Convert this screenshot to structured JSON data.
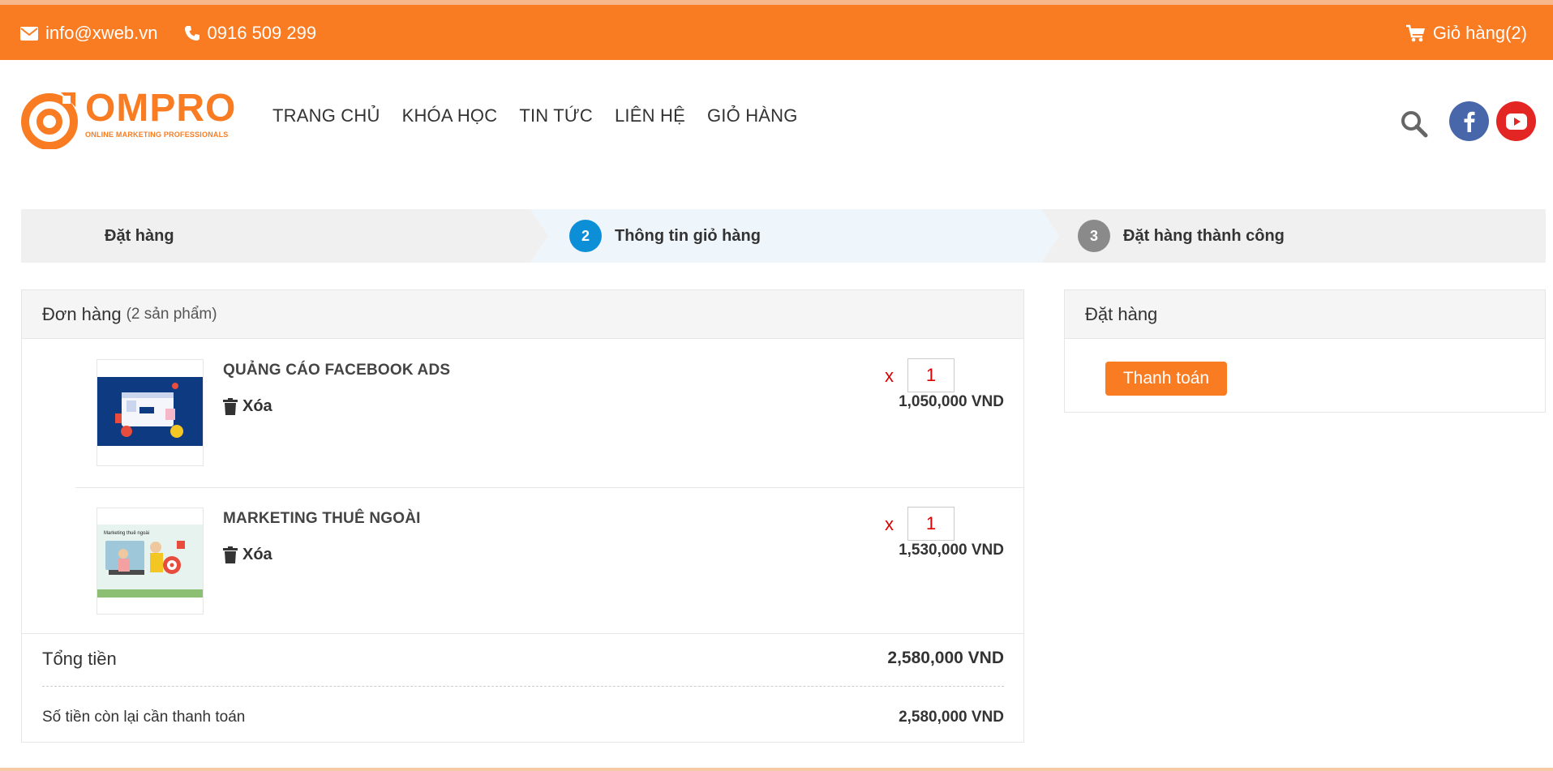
{
  "topbar": {
    "email": "info@xweb.vn",
    "phone": "0916 509 299",
    "cart_label": "Giỏ hàng(2)"
  },
  "logo": {
    "title": "OMPRO",
    "subtitle": "ONLINE MARKETING PROFESSIONALS"
  },
  "nav": {
    "items": [
      {
        "label": "TRANG CHỦ"
      },
      {
        "label": "KHÓA HỌC"
      },
      {
        "label": "TIN TỨC"
      },
      {
        "label": "LIÊN HỆ"
      },
      {
        "label": "GIỎ HÀNG"
      }
    ]
  },
  "steps": [
    {
      "number": "",
      "label": "Đặt hàng"
    },
    {
      "number": "2",
      "label": "Thông tin giỏ hàng"
    },
    {
      "number": "3",
      "label": "Đặt hàng thành công"
    }
  ],
  "order": {
    "title": "Đơn hàng",
    "count": "(2 sản phẩm)",
    "products": [
      {
        "name": "QUẢNG CÁO FACEBOOK ADS",
        "delete_label": "Xóa",
        "x": "x",
        "quantity": "1",
        "price": "1,050,000 VND"
      },
      {
        "name": "MARKETING THUÊ NGOÀI",
        "delete_label": "Xóa",
        "x": "x",
        "quantity": "1",
        "price": "1,530,000 VND"
      }
    ],
    "thumb2_caption": "Marketing thuê ngoài",
    "total_label": "Tổng tiền",
    "total_value": "2,580,000 VND",
    "remaining_label": "Số tiền còn lại cần thanh toán",
    "remaining_value": "2,580,000 VND"
  },
  "checkout": {
    "title": "Đặt hàng",
    "pay_label": "Thanh toán"
  },
  "colors": {
    "brand_orange": "#f97c22",
    "step_active": "#0d8fd8",
    "step_inactive": "#8a8a8a",
    "facebook": "#4867aa",
    "youtube": "#e32524"
  }
}
